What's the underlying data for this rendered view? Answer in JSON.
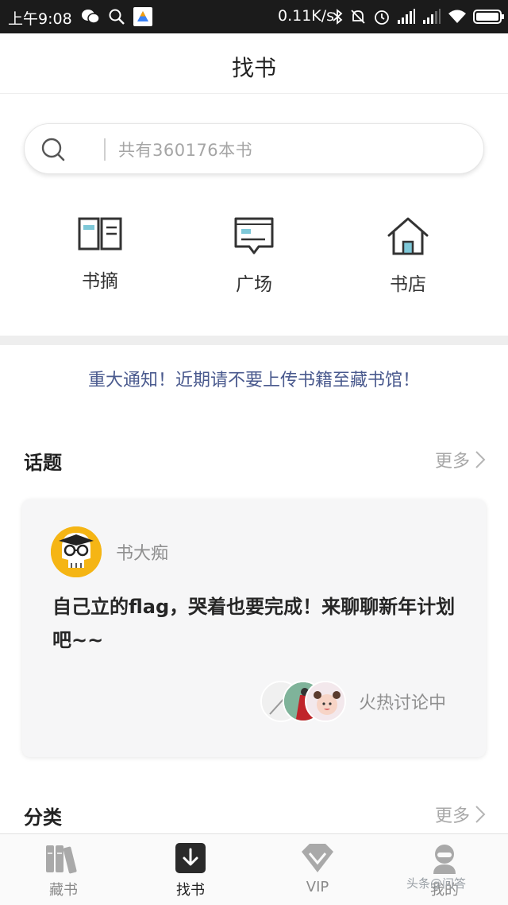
{
  "status_bar": {
    "time": "上午9:08",
    "speed": "0.11K/s",
    "icons": [
      "wechat-icon",
      "search-icon",
      "app-icon",
      "bluetooth-icon",
      "mute-icon",
      "alarm-icon",
      "signal-icon",
      "signal-icon",
      "wifi-icon",
      "battery-icon"
    ]
  },
  "header": {
    "title": "找书"
  },
  "search": {
    "placeholder": "共有360176本书"
  },
  "entries": [
    {
      "label": "书摘",
      "icon": "book-open-icon"
    },
    {
      "label": "广场",
      "icon": "chat-bubble-icon"
    },
    {
      "label": "书店",
      "icon": "house-icon"
    }
  ],
  "notice": "重大通知！近期请不要上传书籍至藏书馆！",
  "topics": {
    "title": "话题",
    "more": "更多",
    "card": {
      "author": "书大痴",
      "text": "自己立的flag，哭着也要完成！来聊聊新年计划吧~~",
      "status": "火热讨论中"
    }
  },
  "categories": {
    "title": "分类",
    "more": "更多"
  },
  "bottom_nav": {
    "items": [
      {
        "label": "藏书",
        "icon": "bookshelf-icon",
        "active": false
      },
      {
        "label": "找书",
        "icon": "download-book-icon",
        "active": true
      },
      {
        "label": "VIP",
        "icon": "diamond-icon",
        "active": false
      },
      {
        "label": "我的",
        "icon": "profile-icon",
        "active": false
      }
    ]
  },
  "watermark": "头条@问答",
  "colors": {
    "accent": "#4a5a8e",
    "avatar_bg": "#f5b514",
    "card_bg": "#f6f6f7"
  }
}
